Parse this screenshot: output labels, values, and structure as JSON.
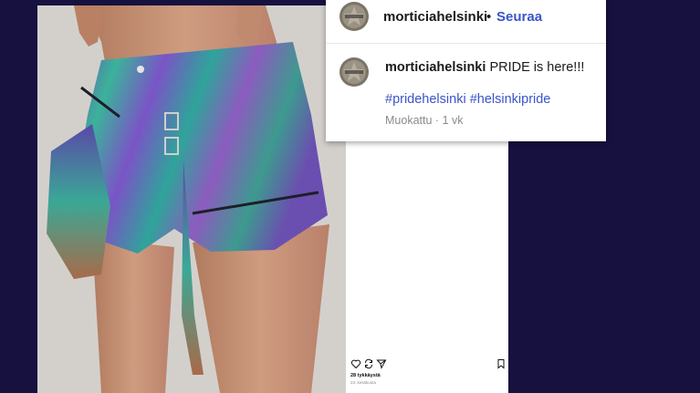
{
  "post": {
    "image_alt": "Iridescent holographic shorts with zippers and belt",
    "likes": "28 tykkäystä",
    "date": "23. kesäkuuta"
  },
  "popup": {
    "username": "morticiahelsinki",
    "separator": "•",
    "follow_label": "Seuraa",
    "caption_user": "morticiahelsinki",
    "caption_text": "PRIDE is here!!!",
    "hashtags": [
      "#pridehelsinki",
      "#helsinkipride"
    ],
    "edited": "Muokattu",
    "meta_sep": "·",
    "age": "1 vk"
  },
  "icons": [
    "heart-icon",
    "repost-icon",
    "share-icon",
    "bookmark-icon"
  ],
  "colors": {
    "background": "#16113f",
    "link": "#3b54c9"
  }
}
